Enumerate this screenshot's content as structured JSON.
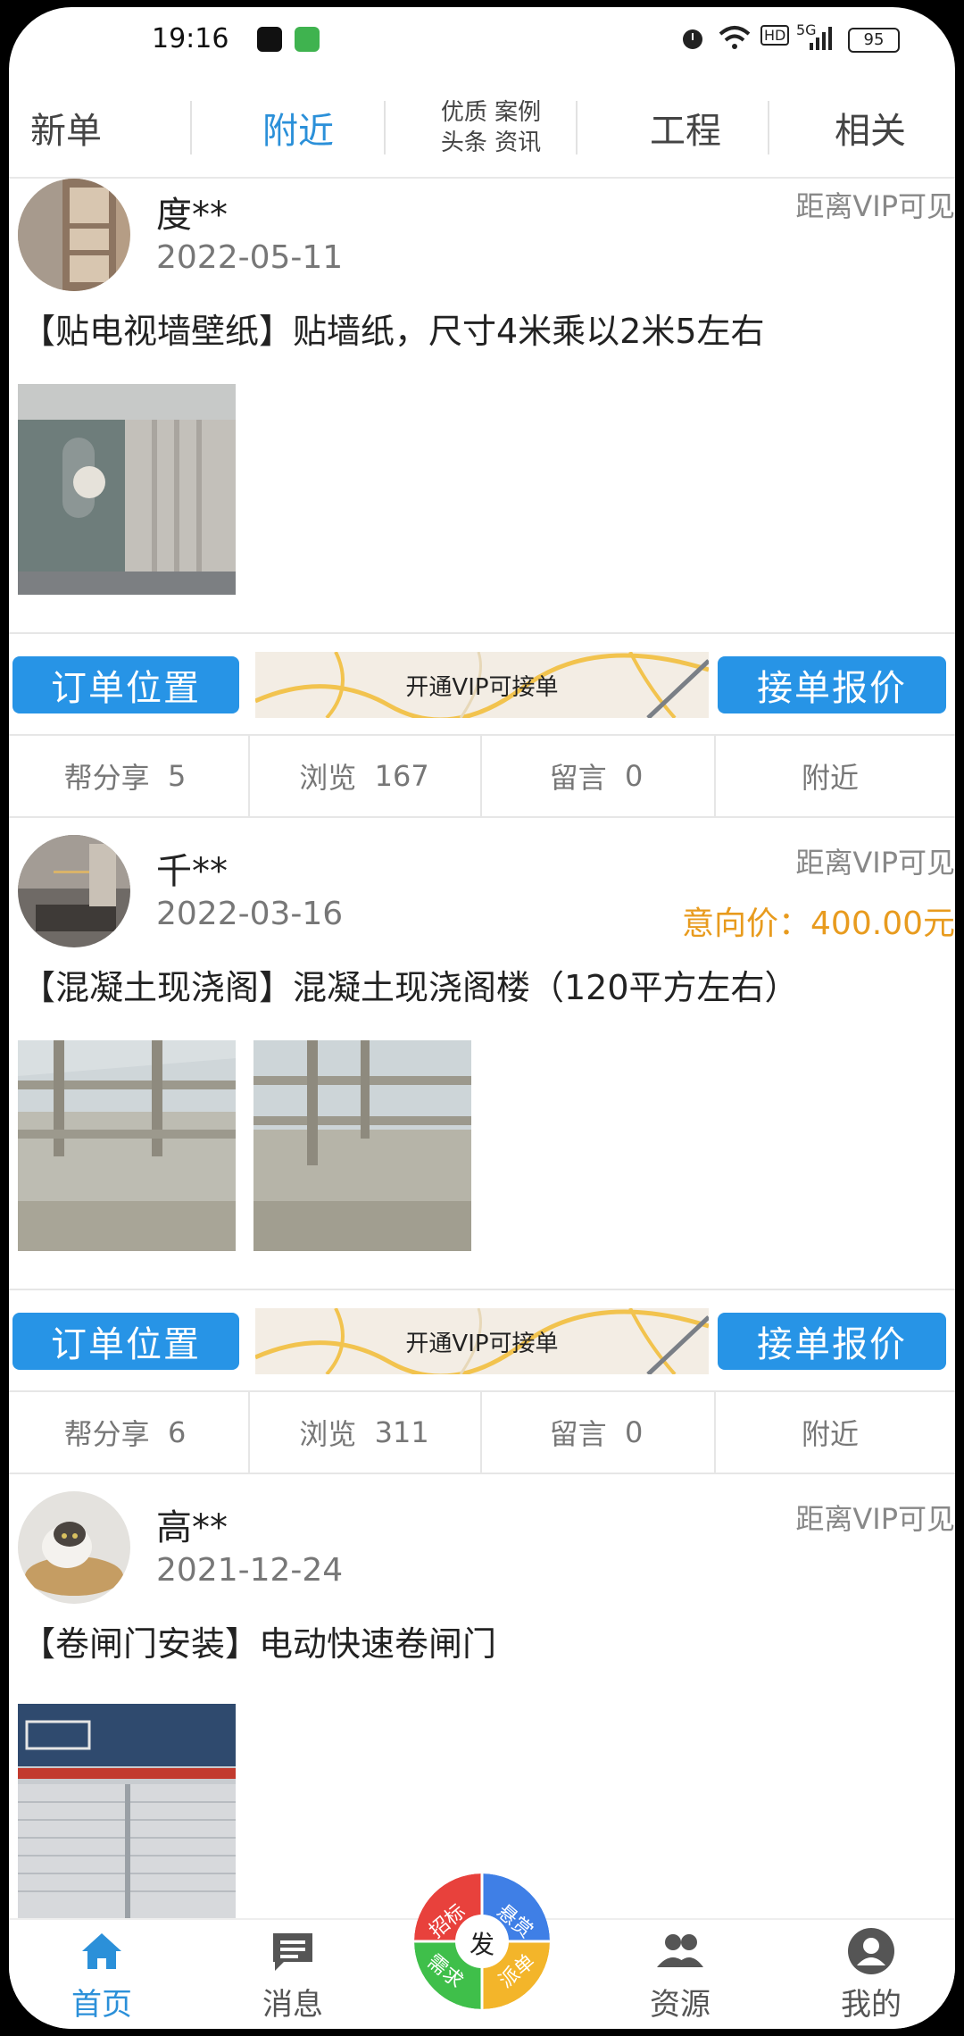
{
  "status_bar": {
    "time": "19:16",
    "network": "5G",
    "hd": "HD",
    "battery": "95"
  },
  "tabs": [
    {
      "label": "新单",
      "active": false
    },
    {
      "label": "附近",
      "active": true
    },
    {
      "label": "优质 案例",
      "label2": "头条 资讯",
      "active": false
    },
    {
      "label": "工程",
      "active": false
    },
    {
      "label": "相关",
      "active": false
    }
  ],
  "common": {
    "vip_note": "距离VIP可见",
    "order_location": "订单位置",
    "map_vip_text": "开通VIP可接单",
    "quote_button": "接单报价",
    "share_label": "帮分享",
    "views_label": "浏览",
    "comments_label": "留言",
    "nearby_label": "附近"
  },
  "orders": [
    {
      "user": "度**",
      "date": "2022-05-11",
      "price": "",
      "title": "【贴电视墙壁纸】贴墙纸，尺寸4米乘以2米5左右",
      "shares": "5",
      "views": "167",
      "comments": "0"
    },
    {
      "user": "千**",
      "date": "2022-03-16",
      "price": "意向价：400.00元",
      "title": "【混凝土现浇阁】混凝土现浇阁楼（120平方左右）",
      "shares": "6",
      "views": "311",
      "comments": "0"
    },
    {
      "user": "高**",
      "date": "2021-12-24",
      "price": "",
      "title": "【卷闸门安装】电动快速卷闸门"
    }
  ],
  "bottom_nav": {
    "home": "首页",
    "messages": "消息",
    "publish": "发",
    "fab_segments": [
      "招标",
      "悬赏",
      "需求",
      "派单"
    ],
    "resources": "资源",
    "mine": "我的"
  },
  "colors": {
    "accent": "#2794e6",
    "price": "#e89b1e",
    "active_tab": "#2b90d9"
  }
}
